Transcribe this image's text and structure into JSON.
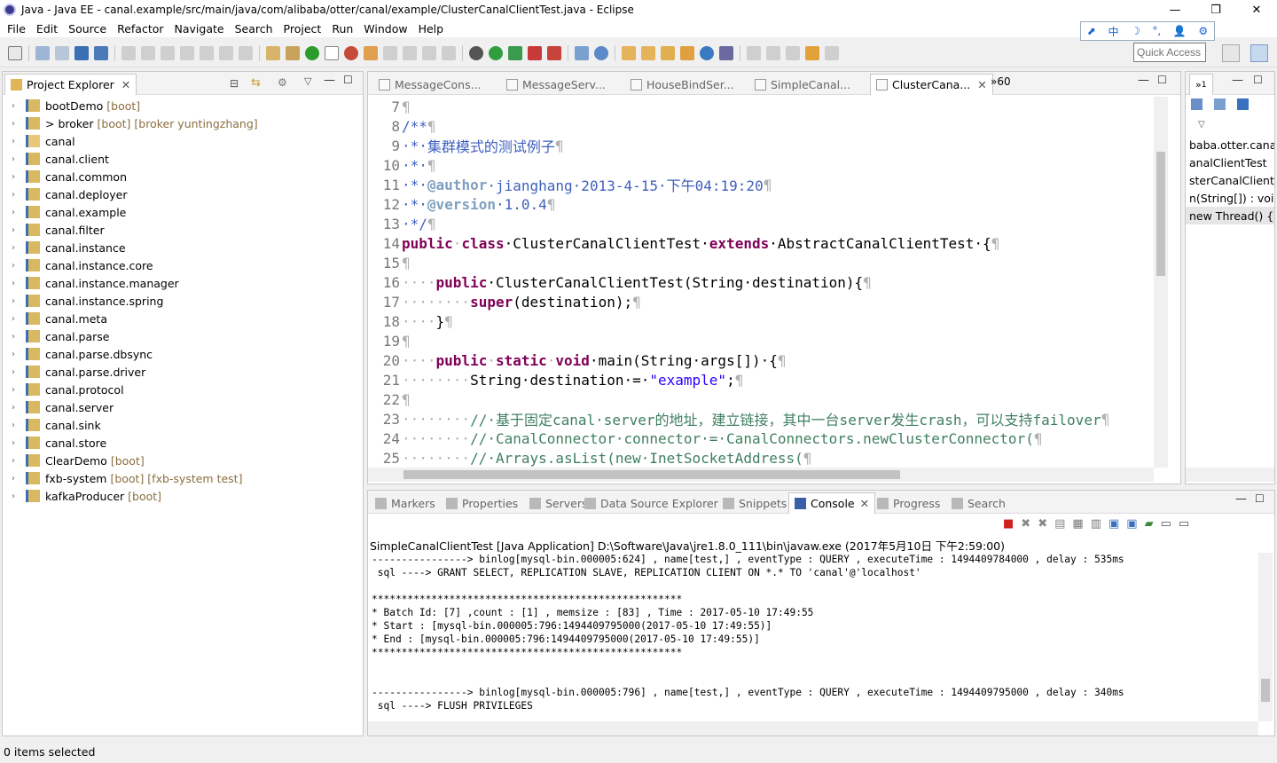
{
  "window": {
    "title": "Java - Java EE - canal.example/src/main/java/com/alibaba/otter/canal/example/ClusterCanalClientTest.java - Eclipse",
    "min": "—",
    "max": "❐",
    "close": "✕"
  },
  "menu": [
    "File",
    "Edit",
    "Source",
    "Refactor",
    "Navigate",
    "Search",
    "Project",
    "Run",
    "Window",
    "Help"
  ],
  "ime": [
    "⬈",
    "中",
    "☽",
    "°,",
    "👤",
    "⚙"
  ],
  "toolbar": {
    "quick_access_placeholder": "Quick Access"
  },
  "project_explorer": {
    "tab_label": "Project Explorer",
    "items": [
      {
        "name": "bootDemo",
        "tag": "[boot]"
      },
      {
        "name": "> broker",
        "tag": "[boot] [broker yuntingzhang]"
      },
      {
        "name": "canal",
        "tag": ""
      },
      {
        "name": "canal.client",
        "tag": ""
      },
      {
        "name": "canal.common",
        "tag": ""
      },
      {
        "name": "canal.deployer",
        "tag": ""
      },
      {
        "name": "canal.example",
        "tag": ""
      },
      {
        "name": "canal.filter",
        "tag": ""
      },
      {
        "name": "canal.instance",
        "tag": ""
      },
      {
        "name": "canal.instance.core",
        "tag": ""
      },
      {
        "name": "canal.instance.manager",
        "tag": ""
      },
      {
        "name": "canal.instance.spring",
        "tag": ""
      },
      {
        "name": "canal.meta",
        "tag": ""
      },
      {
        "name": "canal.parse",
        "tag": ""
      },
      {
        "name": "canal.parse.dbsync",
        "tag": ""
      },
      {
        "name": "canal.parse.driver",
        "tag": ""
      },
      {
        "name": "canal.protocol",
        "tag": ""
      },
      {
        "name": "canal.server",
        "tag": ""
      },
      {
        "name": "canal.sink",
        "tag": ""
      },
      {
        "name": "canal.store",
        "tag": ""
      },
      {
        "name": "ClearDemo",
        "tag": "[boot]"
      },
      {
        "name": "fxb-system",
        "tag": "[boot] [fxb-system test]"
      },
      {
        "name": "kafkaProducer",
        "tag": "[boot]"
      }
    ]
  },
  "editor": {
    "tabs": [
      "MessageCons...",
      "MessageServ...",
      "HouseBindSer...",
      "SimpleCanal...",
      "ClusterCana..."
    ],
    "overflow": "»60",
    "lines": [
      {
        "n": "7",
        "parts": [
          {
            "t": "¶",
            "c": "ws"
          }
        ]
      },
      {
        "n": "8",
        "parts": [
          {
            "t": "/**",
            "c": "jd"
          },
          {
            "t": "¶",
            "c": "ws"
          }
        ]
      },
      {
        "n": "9",
        "parts": [
          {
            "t": "·*·",
            "c": "jd"
          },
          {
            "t": "集群模式的测试例子",
            "c": "jd"
          },
          {
            "t": "¶",
            "c": "ws"
          }
        ]
      },
      {
        "n": "10",
        "parts": [
          {
            "t": "·*·",
            "c": "jd"
          },
          {
            "t": "¶",
            "c": "ws"
          }
        ]
      },
      {
        "n": "11",
        "parts": [
          {
            "t": "·*·",
            "c": "jd"
          },
          {
            "t": "@author",
            "c": "jdtag"
          },
          {
            "t": "·jianghang·2013-4-15·下午04:19:20",
            "c": "jd"
          },
          {
            "t": "¶",
            "c": "ws"
          }
        ]
      },
      {
        "n": "12",
        "parts": [
          {
            "t": "·*·",
            "c": "jd"
          },
          {
            "t": "@version",
            "c": "jdtag"
          },
          {
            "t": "·1.0.4",
            "c": "jd"
          },
          {
            "t": "¶",
            "c": "ws"
          }
        ]
      },
      {
        "n": "13",
        "parts": [
          {
            "t": "·*/",
            "c": "jd"
          },
          {
            "t": "¶",
            "c": "ws"
          }
        ]
      },
      {
        "n": "14",
        "parts": [
          {
            "t": "public",
            "c": "kw"
          },
          {
            "t": "·",
            "c": "ws"
          },
          {
            "t": "class",
            "c": "kw"
          },
          {
            "t": "·ClusterCanalClientTest·",
            "c": "ct"
          },
          {
            "t": "extends",
            "c": "kw"
          },
          {
            "t": "·AbstractCanalClientTest·{",
            "c": "ct"
          },
          {
            "t": "¶",
            "c": "ws"
          }
        ]
      },
      {
        "n": "15",
        "parts": [
          {
            "t": "¶",
            "c": "ws"
          }
        ]
      },
      {
        "n": "16",
        "parts": [
          {
            "t": "····",
            "c": "ws"
          },
          {
            "t": "public",
            "c": "kw"
          },
          {
            "t": "·ClusterCanalClientTest(String·destination){",
            "c": "ct"
          },
          {
            "t": "¶",
            "c": "ws"
          }
        ]
      },
      {
        "n": "17",
        "parts": [
          {
            "t": "········",
            "c": "ws"
          },
          {
            "t": "super",
            "c": "kw"
          },
          {
            "t": "(destination);",
            "c": "ct"
          },
          {
            "t": "¶",
            "c": "ws"
          }
        ]
      },
      {
        "n": "18",
        "parts": [
          {
            "t": "····",
            "c": "ws"
          },
          {
            "t": "}",
            "c": "ct"
          },
          {
            "t": "¶",
            "c": "ws"
          }
        ]
      },
      {
        "n": "19",
        "parts": [
          {
            "t": "¶",
            "c": "ws"
          }
        ]
      },
      {
        "n": "20",
        "parts": [
          {
            "t": "····",
            "c": "ws"
          },
          {
            "t": "public",
            "c": "kw"
          },
          {
            "t": "·",
            "c": "ws"
          },
          {
            "t": "static",
            "c": "kw"
          },
          {
            "t": "·",
            "c": "ws"
          },
          {
            "t": "void",
            "c": "kw"
          },
          {
            "t": "·main(String·args[])·{",
            "c": "ct"
          },
          {
            "t": "¶",
            "c": "ws"
          }
        ]
      },
      {
        "n": "21",
        "parts": [
          {
            "t": "········",
            "c": "ws"
          },
          {
            "t": "String·destination·=·",
            "c": "ct"
          },
          {
            "t": "\"example\"",
            "c": "str"
          },
          {
            "t": ";",
            "c": "ct"
          },
          {
            "t": "¶",
            "c": "ws"
          }
        ]
      },
      {
        "n": "22",
        "parts": [
          {
            "t": "¶",
            "c": "ws"
          }
        ]
      },
      {
        "n": "23",
        "parts": [
          {
            "t": "········",
            "c": "ws"
          },
          {
            "t": "//·基于固定canal·server的地址，建立链接，其中一台server发生crash，可以支持failover",
            "c": "cm"
          },
          {
            "t": "¶",
            "c": "ws"
          }
        ]
      },
      {
        "n": "24",
        "parts": [
          {
            "t": "········",
            "c": "ws"
          },
          {
            "t": "//·CanalConnector·connector·=·CanalConnectors.newClusterConnector(",
            "c": "cm"
          },
          {
            "t": "¶",
            "c": "ws"
          }
        ]
      },
      {
        "n": "25",
        "parts": [
          {
            "t": "········",
            "c": "ws"
          },
          {
            "t": "//·Arrays.asList(new·InetSocketAddress(",
            "c": "cm"
          },
          {
            "t": "¶",
            "c": "ws"
          }
        ]
      }
    ]
  },
  "outline": {
    "tab_label": "1",
    "items": [
      "baba.otter.canal.e",
      "analClientTest",
      "sterCanalClientTe",
      "n(String[]) : void",
      "new Thread() {..."
    ]
  },
  "console": {
    "tabs": [
      "Markers",
      "Properties",
      "Servers",
      "Data Source Explorer",
      "Snippets",
      "Console",
      "Progress",
      "Search"
    ],
    "active_tab": "Console",
    "label": "SimpleCanalClientTest [Java Application] D:\\Software\\Java\\jre1.8.0_111\\bin\\javaw.exe (2017年5月10日 下午2:59:00)",
    "lines": [
      "----------------> binlog[mysql-bin.000005:624] , name[test,] , eventType : QUERY , executeTime : 1494409784000 , delay : 535ms",
      " sql ----> GRANT SELECT, REPLICATION SLAVE, REPLICATION CLIENT ON *.* TO 'canal'@'localhost'",
      "",
      "****************************************************",
      "* Batch Id: [7] ,count : [1] , memsize : [83] , Time : 2017-05-10 17:49:55",
      "* Start : [mysql-bin.000005:796:1494409795000(2017-05-10 17:49:55)]",
      "* End : [mysql-bin.000005:796:1494409795000(2017-05-10 17:49:55)]",
      "****************************************************",
      "",
      "",
      "----------------> binlog[mysql-bin.000005:796] , name[test,] , eventType : QUERY , executeTime : 1494409795000 , delay : 340ms",
      " sql ----> FLUSH PRIVILEGES"
    ]
  },
  "status": {
    "text": "0 items selected"
  }
}
